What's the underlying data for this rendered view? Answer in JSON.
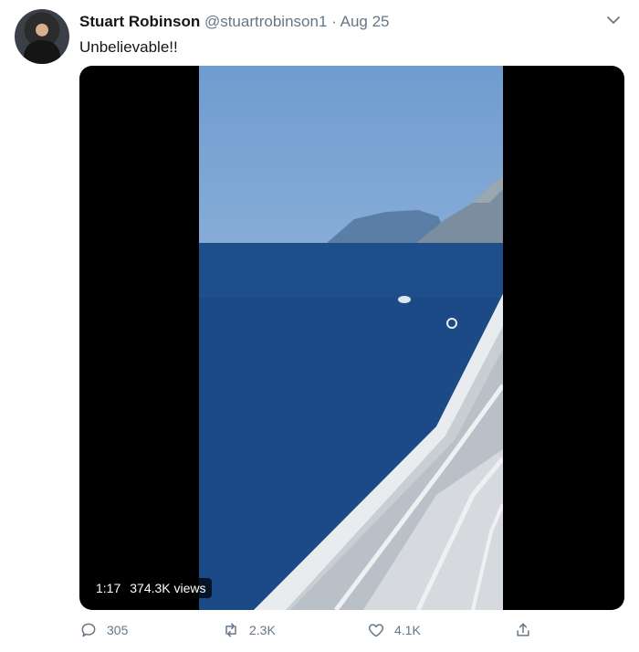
{
  "tweet": {
    "author_name": "Stuart Robinson",
    "handle": "@stuartrobinson1",
    "separator": "·",
    "date": "Aug 25",
    "text": "Unbelievable!!"
  },
  "video": {
    "duration": "1:17",
    "views": "374.3K views"
  },
  "actions": {
    "reply_count": "305",
    "retweet_count": "2.3K",
    "like_count": "4.1K"
  },
  "icons": {
    "reply": "speech-bubble-icon",
    "retweet": "retweet-icon",
    "like": "heart-icon",
    "share": "share-icon",
    "menu": "chevron-down-icon"
  }
}
